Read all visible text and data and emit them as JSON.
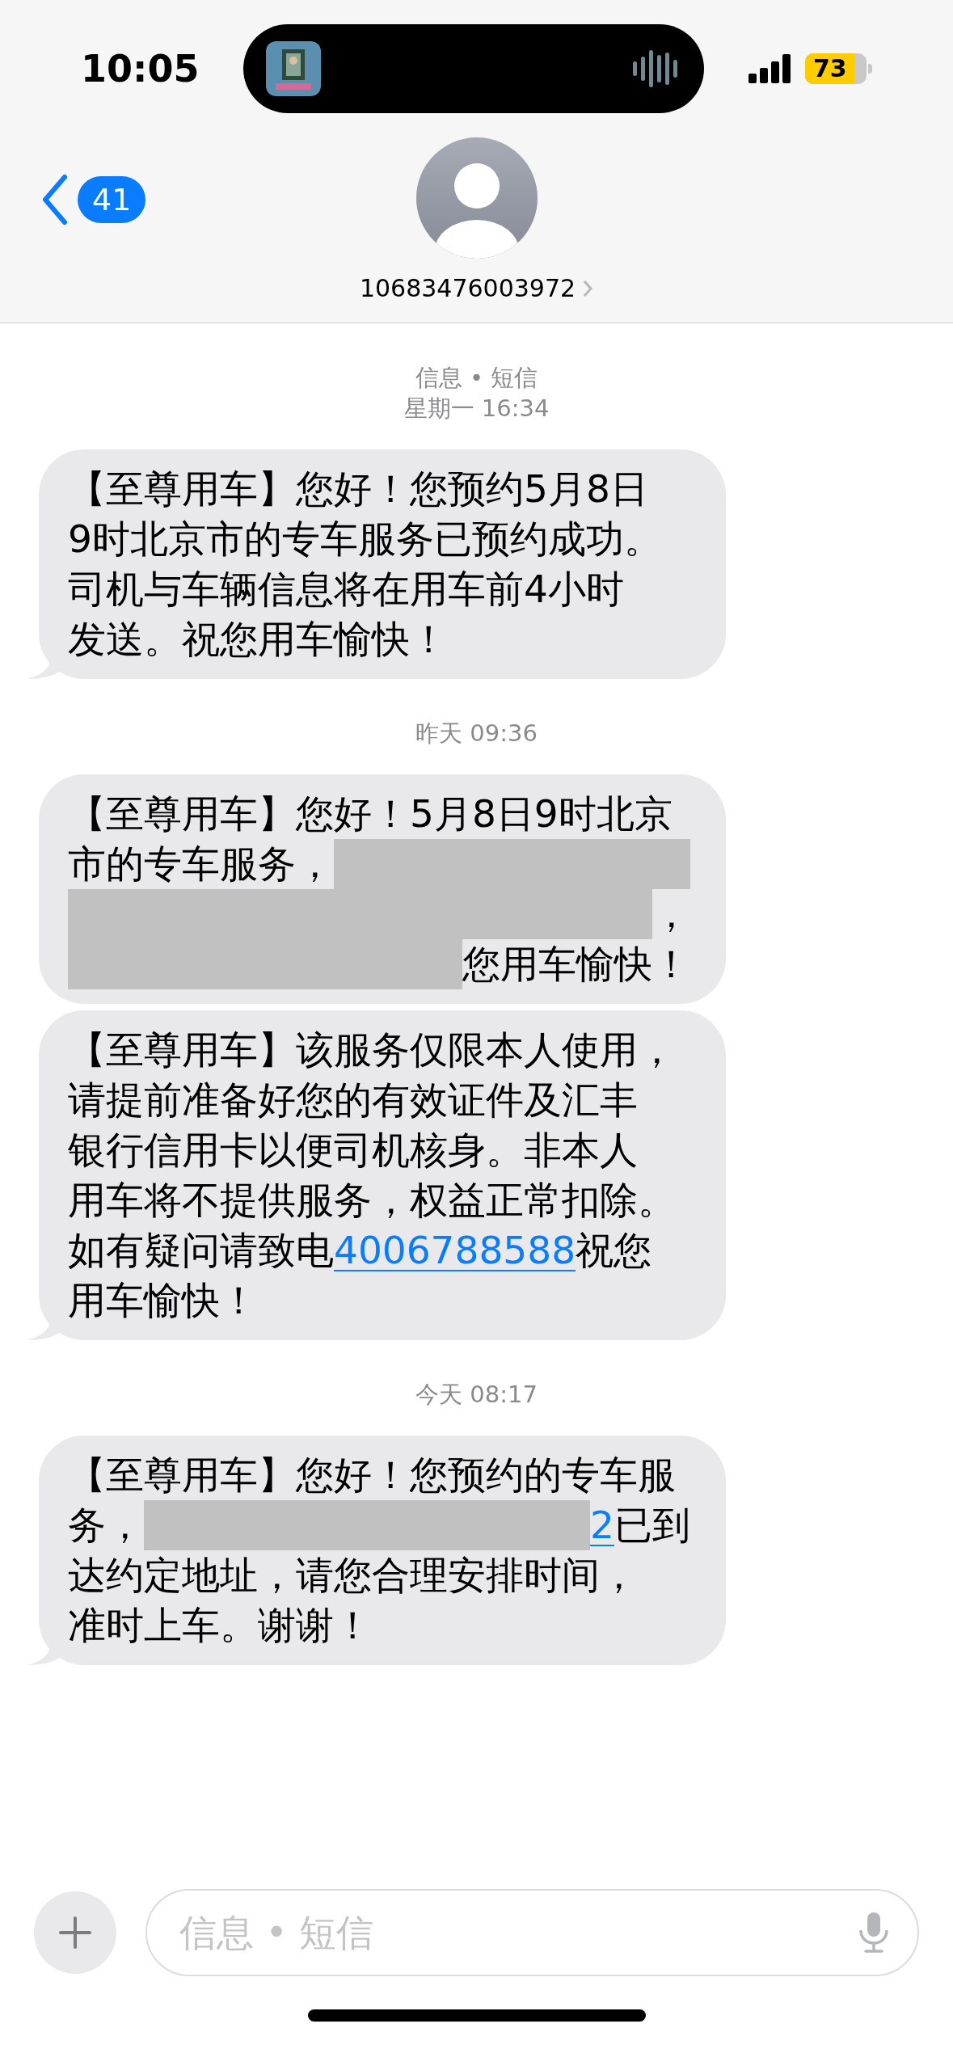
{
  "status_bar": {
    "time": "10:05",
    "battery": "73"
  },
  "nav": {
    "back_count": "41",
    "contact": "10683476003972"
  },
  "thread": [
    {
      "kind": "timestamp",
      "lines": [
        "信息 • 短信",
        "星期一 16:34"
      ]
    },
    {
      "kind": "message",
      "tail": true,
      "lines": [
        [
          {
            "kind": "text",
            "text": "【至尊用车】您好！您预约5月8日"
          }
        ],
        [
          {
            "kind": "text",
            "text": "9时北京市的专车服务已预约成功。"
          }
        ],
        [
          {
            "kind": "text",
            "text": "司机与车辆信息将在用车前4小时"
          }
        ],
        [
          {
            "kind": "text",
            "text": "发送。祝您用车愉快！"
          }
        ]
      ]
    },
    {
      "kind": "timestamp",
      "lines": [
        "昨天 09:36"
      ]
    },
    {
      "kind": "message",
      "tail": false,
      "lines": [
        [
          {
            "kind": "text",
            "text": "【至尊用车】您好！5月8日9时北京"
          }
        ],
        [
          {
            "kind": "text",
            "text": "市的专车服务，"
          },
          {
            "kind": "redacted"
          }
        ],
        [
          {
            "kind": "redacted"
          },
          {
            "kind": "text",
            "text": "，"
          }
        ],
        [
          {
            "kind": "redacted"
          },
          {
            "kind": "text",
            "text": "您用车愉快！"
          }
        ]
      ]
    },
    {
      "kind": "message",
      "tail": true,
      "lines": [
        [
          {
            "kind": "text",
            "text": "【至尊用车】该服务仅限本人使用，"
          }
        ],
        [
          {
            "kind": "text",
            "text": "请提前准备好您的有效证件及汇丰"
          }
        ],
        [
          {
            "kind": "text",
            "text": "银行信用卡以便司机核身。非本人"
          }
        ],
        [
          {
            "kind": "text",
            "text": "用车将不提供服务，权益正常扣除。"
          }
        ],
        [
          {
            "kind": "text",
            "text": "如有疑问请致电"
          },
          {
            "kind": "link",
            "text": "4006788588"
          },
          {
            "kind": "text",
            "text": "祝您"
          }
        ],
        [
          {
            "kind": "text",
            "text": "用车愉快！"
          }
        ]
      ]
    },
    {
      "kind": "timestamp",
      "lines": [
        "今天 08:17"
      ]
    },
    {
      "kind": "message",
      "tail": true,
      "lines": [
        [
          {
            "kind": "text",
            "text": "【至尊用车】您好！您预约的专车服"
          }
        ],
        [
          {
            "kind": "text",
            "text": "务，"
          },
          {
            "kind": "redacted"
          },
          {
            "kind": "link",
            "text": "2"
          },
          {
            "kind": "text",
            "text": "已到"
          }
        ],
        [
          {
            "kind": "text",
            "text": "达约定地址，请您合理安排时间，"
          }
        ],
        [
          {
            "kind": "text",
            "text": "准时上车。谢谢！"
          }
        ]
      ]
    }
  ],
  "composer": {
    "placeholder": "信息 • 短信"
  }
}
